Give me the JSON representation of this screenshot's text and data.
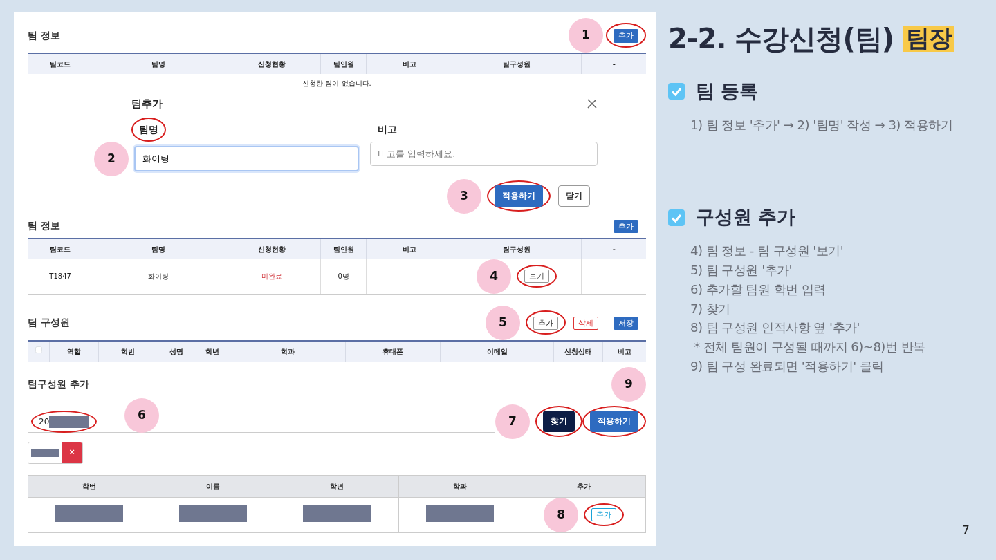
{
  "slide": {
    "title": "2-2. 수강신청(팀)",
    "title_tag": "팀장",
    "page_number": "7"
  },
  "sections": [
    {
      "checked": true,
      "heading": "팀 등록",
      "lines": [
        "1) 팀 정보 '추가' → 2) '팀명' 작성 → 3) 적용하기"
      ]
    },
    {
      "checked": true,
      "heading": "구성원 추가",
      "lines": [
        "4) 팀 정보 - 팀 구성원 '보기'",
        "5) 팀 구성원 '추가'",
        "6) 추가할 팀원 학번 입력",
        "7) 찾기",
        "8) 팀 구성원 인적사항 옆 '추가'",
        " * 전체 팀원이 구성될 때까지 6)~8)번 반복",
        "9) 팀 구성 완료되면 '적용하기' 클릭"
      ]
    }
  ],
  "team_info_empty": {
    "title": "팀 정보",
    "add_button": {
      "label": "추가",
      "step": "1",
      "circled": true
    },
    "columns": [
      "팀코드",
      "팀명",
      "신청현황",
      "팀인원",
      "비고",
      "팀구성원",
      "-"
    ],
    "empty_message": "신청한 팀이 없습니다."
  },
  "team_add_modal": {
    "title": "팀추가",
    "fields": [
      {
        "label": "팀명",
        "value": "화이팅",
        "focused": true,
        "step": "2",
        "label_circled": true
      },
      {
        "label": "비고",
        "placeholder": "비고를 입력하세요.",
        "focused": false
      }
    ],
    "buttons": [
      {
        "label": "적용하기",
        "kind": "primary",
        "step": "3",
        "circled": true
      },
      {
        "label": "닫기",
        "kind": "outline",
        "circled": false
      }
    ]
  },
  "team_info": {
    "title": "팀 정보",
    "add_button": {
      "label": "추가"
    },
    "columns": [
      "팀코드",
      "팀명",
      "신청현황",
      "팀인원",
      "비고",
      "팀구성원",
      "-"
    ],
    "rows": [
      {
        "code": "T1847",
        "name": "화이팅",
        "status": "미완료",
        "status_complete": false,
        "member_count": "0명",
        "note": "-",
        "members_button": {
          "label": "보기",
          "step": "4",
          "circled": true
        },
        "extra": "-"
      }
    ]
  },
  "team_members": {
    "title": "팀 구성원",
    "select_all_checked": false,
    "buttons": [
      {
        "label": "추가",
        "kind": "outline",
        "step": "5",
        "circled": true
      },
      {
        "label": "삭제",
        "kind": "danger"
      },
      {
        "label": "저장",
        "kind": "primary"
      }
    ],
    "columns": [
      "역할",
      "학번",
      "성명",
      "학년",
      "학과",
      "휴대폰",
      "이메일",
      "신청상태",
      "비고"
    ]
  },
  "member_add": {
    "title": "팀구성원 추가",
    "search": {
      "value": "20",
      "redacted": true,
      "step": "6",
      "circled": true
    },
    "search_button": {
      "label": "찾기",
      "kind": "dark",
      "step": "7",
      "circled": true
    },
    "apply_button": {
      "label": "적용하기",
      "kind": "primary",
      "step": "9",
      "circled": true
    },
    "chips": [
      {
        "redacted": true,
        "remove": "×"
      }
    ],
    "columns": [
      "학번",
      "이름",
      "학년",
      "학과",
      "추가"
    ],
    "rows": [
      {
        "redacted": true,
        "add_button": {
          "label": "추가",
          "step": "8",
          "circled": true
        }
      }
    ]
  }
}
